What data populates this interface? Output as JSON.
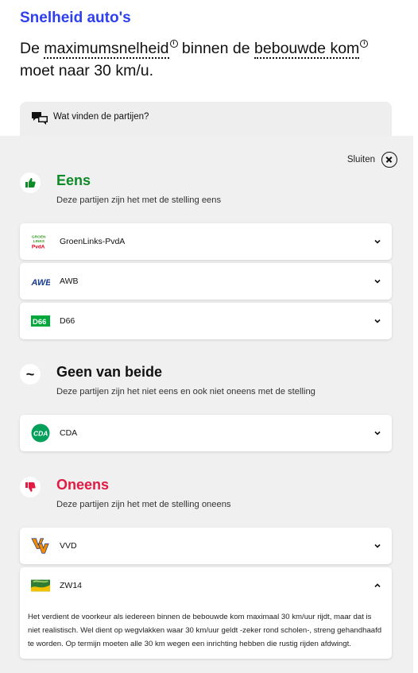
{
  "topic": "Snelheid auto's",
  "statement": {
    "part1": "De ",
    "term1": "maximumsnelheid",
    "part2": " binnen de ",
    "term2": "bebouwde kom",
    "part3": " moet naar 30 km/u.",
    "info_glyph": "i"
  },
  "parties_toggle_label": "Wat vinden de partijen?",
  "close_label": "Sluiten",
  "sections": {
    "agree": {
      "title": "Eens",
      "subtitle": "Deze partijen zijn het met de stelling eens",
      "color": "#0f8a28"
    },
    "neutral": {
      "title": "Geen van beide",
      "subtitle": "Deze partijen zijn het niet eens en ook niet oneens met de stelling",
      "symbol": "~",
      "color": "#111111"
    },
    "disagree": {
      "title": "Oneens",
      "subtitle": "Deze partijen zijn het met de stelling oneens",
      "color": "#e01b44"
    }
  },
  "parties": {
    "groenlinks": {
      "name": "GroenLinks-PvdA",
      "logo_text": [
        "GROEN",
        "LINKS",
        "PvdA"
      ]
    },
    "awb": {
      "name": "AWB",
      "logo_text": "AWB"
    },
    "d66": {
      "name": "D66",
      "logo_text": "D66"
    },
    "cda": {
      "name": "CDA",
      "logo_text": "CDA"
    },
    "vvd": {
      "name": "VVD",
      "logo_text": "VVD"
    },
    "zw14": {
      "name": "ZW14",
      "argument": "Het verdient de voorkeur als iedereen binnen de bebouwde kom maximaal 30 km/uur rijdt, maar dat is niet realistisch. Wel dient op wegvlakken waar 30 km/uur geldt -zeker rond scholen-, streng gehandhaafd te worden. Op termijn moeten alle 30 km wegen een inrichting hebben die rustig rijden afdwingt."
    }
  },
  "icons": {
    "agree": "thumbs-up-icon",
    "disagree": "thumbs-down-icon",
    "chat": "chat-bubbles-icon",
    "close": "close-icon",
    "expand": "chevron-down-icon",
    "collapse": "chevron-up-icon"
  }
}
